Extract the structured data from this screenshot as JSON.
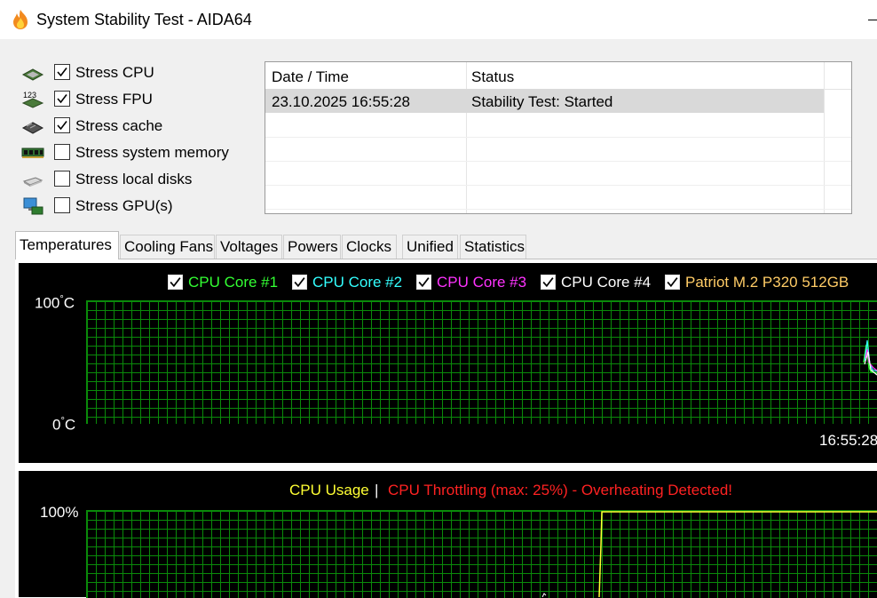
{
  "window": {
    "title": "System Stability Test - AIDA64"
  },
  "options": [
    {
      "label": "Stress CPU",
      "checked": true,
      "icon": "cpu-icon"
    },
    {
      "label": "Stress FPU",
      "checked": true,
      "icon": "fpu-icon"
    },
    {
      "label": "Stress cache",
      "checked": true,
      "icon": "cache-icon"
    },
    {
      "label": "Stress system memory",
      "checked": false,
      "icon": "memory-icon"
    },
    {
      "label": "Stress local disks",
      "checked": false,
      "icon": "disk-icon"
    },
    {
      "label": "Stress GPU(s)",
      "checked": false,
      "icon": "gpu-icon"
    }
  ],
  "log": {
    "columns": [
      "Date / Time",
      "Status"
    ],
    "rows": [
      {
        "datetime": "23.10.2025 16:55:28",
        "status": "Stability Test: Started"
      }
    ]
  },
  "tabs": [
    "Temperatures",
    "Cooling Fans",
    "Voltages",
    "Powers",
    "Clocks",
    "Unified",
    "Statistics"
  ],
  "active_tab": "Temperatures",
  "temperature_graph": {
    "legend": [
      {
        "label": "CPU Core #1",
        "color": "#33ff33",
        "checked": true
      },
      {
        "label": "CPU Core #2",
        "color": "#33ffff",
        "checked": true
      },
      {
        "label": "CPU Core #3",
        "color": "#ff33ff",
        "checked": true
      },
      {
        "label": "CPU Core #4",
        "color": "#ffffff",
        "checked": true
      },
      {
        "label": "Patriot M.2 P320 512GB",
        "color": "#ffcc66",
        "checked": true
      }
    ],
    "y_max_label": "100",
    "y_min_label": "0",
    "unit": "C",
    "time_label": "16:55:28"
  },
  "usage_graph": {
    "title_usage": "CPU Usage",
    "separator": "|",
    "title_throttle": "CPU Throttling (max: 25%) - Overheating Detected!",
    "usage_color": "#ffff33",
    "throttle_color": "#ff2222",
    "y_max_label": "100%"
  },
  "chart_data": [
    {
      "type": "line",
      "title": "",
      "ylabel": "°C",
      "ylim": [
        0,
        100
      ],
      "x": [
        "16:55:28"
      ],
      "series": [
        {
          "name": "CPU Core #1",
          "values": [
            45
          ]
        },
        {
          "name": "CPU Core #2",
          "values": [
            48
          ]
        },
        {
          "name": "CPU Core #3",
          "values": [
            50
          ]
        },
        {
          "name": "CPU Core #4",
          "values": [
            44
          ]
        },
        {
          "name": "Patriot M.2 P320 512GB",
          "values": [
            40
          ]
        }
      ]
    },
    {
      "type": "line",
      "title": "CPU Usage",
      "ylim": [
        0,
        100
      ],
      "series": [
        {
          "name": "CPU Usage",
          "values": [
            0,
            0,
            100,
            100
          ]
        }
      ]
    }
  ]
}
